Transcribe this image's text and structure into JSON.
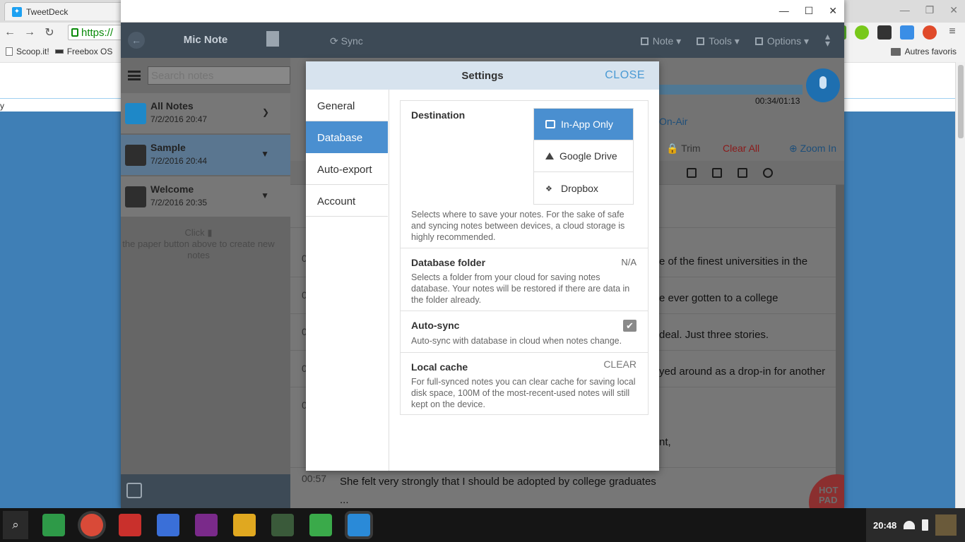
{
  "chrome": {
    "tab_title": "TweetDeck",
    "url_visible": "https://",
    "bookmarks": [
      "Scoop.it!",
      "Freebox OS"
    ],
    "bookmarks_right": "Autres favoris",
    "page_char": "y"
  },
  "app": {
    "title": "Mic Note",
    "sync_label": "Sync",
    "menus": [
      "Note",
      "Tools",
      "Options"
    ],
    "search_placeholder": "Search notes",
    "notes": [
      {
        "title": "All Notes",
        "date": "7/2/2016 20:47"
      },
      {
        "title": "Sample",
        "date": "7/2/2016 20:44"
      },
      {
        "title": "Welcome",
        "date": "7/2/2016 20:35"
      }
    ],
    "hint_click": "Click",
    "hint_rest": "the paper button above to create new notes",
    "timer": "00:34/01:13",
    "onair": "On-Air",
    "trim": "Trim",
    "clear_all": "Clear All",
    "zoom_in": "Zoom In",
    "transcript": [
      {
        "time": "0",
        "text": "e of the finest universities in the"
      },
      {
        "time": "0",
        "text": "e ever gotten to a college"
      },
      {
        "time": "0",
        "text": "deal. Just three stories."
      },
      {
        "time": "0",
        "text": "yed around as a drop-in for another"
      },
      {
        "time": "0",
        "text": "nt,"
      },
      {
        "time": "00:57",
        "text": "She felt very strongly that I should be adopted by college graduates"
      },
      {
        "time": "",
        "text": "..."
      }
    ],
    "hotpad": [
      "HOT",
      "PAD"
    ]
  },
  "settings": {
    "title": "Settings",
    "close_label": "CLOSE",
    "nav": [
      "General",
      "Database",
      "Auto-export",
      "Account"
    ],
    "active_nav": "Database",
    "destination": {
      "title": "Destination",
      "options": [
        "In-App Only",
        "Google Drive",
        "Dropbox"
      ],
      "selected": "In-App Only",
      "desc": "Selects where to save your notes. For the sake of safe and syncing notes between devices, a cloud storage is highly recommended."
    },
    "db_folder": {
      "title": "Database folder",
      "value": "N/A",
      "desc": "Selects a folder from your cloud for saving notes database. Your notes will be restored if there are data in the folder already."
    },
    "autosync": {
      "title": "Auto-sync",
      "checked": true,
      "desc": "Auto-sync with database in cloud when notes change."
    },
    "local_cache": {
      "title": "Local cache",
      "action": "CLEAR",
      "desc": "For full-synced notes you can clear cache for saving local disk space, 100M of the most-recent-used notes will still kept on the device."
    }
  },
  "taskbar": {
    "time": "20:48"
  },
  "colors": {
    "accent": "#4a8fd0",
    "header_dark": "#3d4a56",
    "close_link": "#4a9ad4"
  }
}
